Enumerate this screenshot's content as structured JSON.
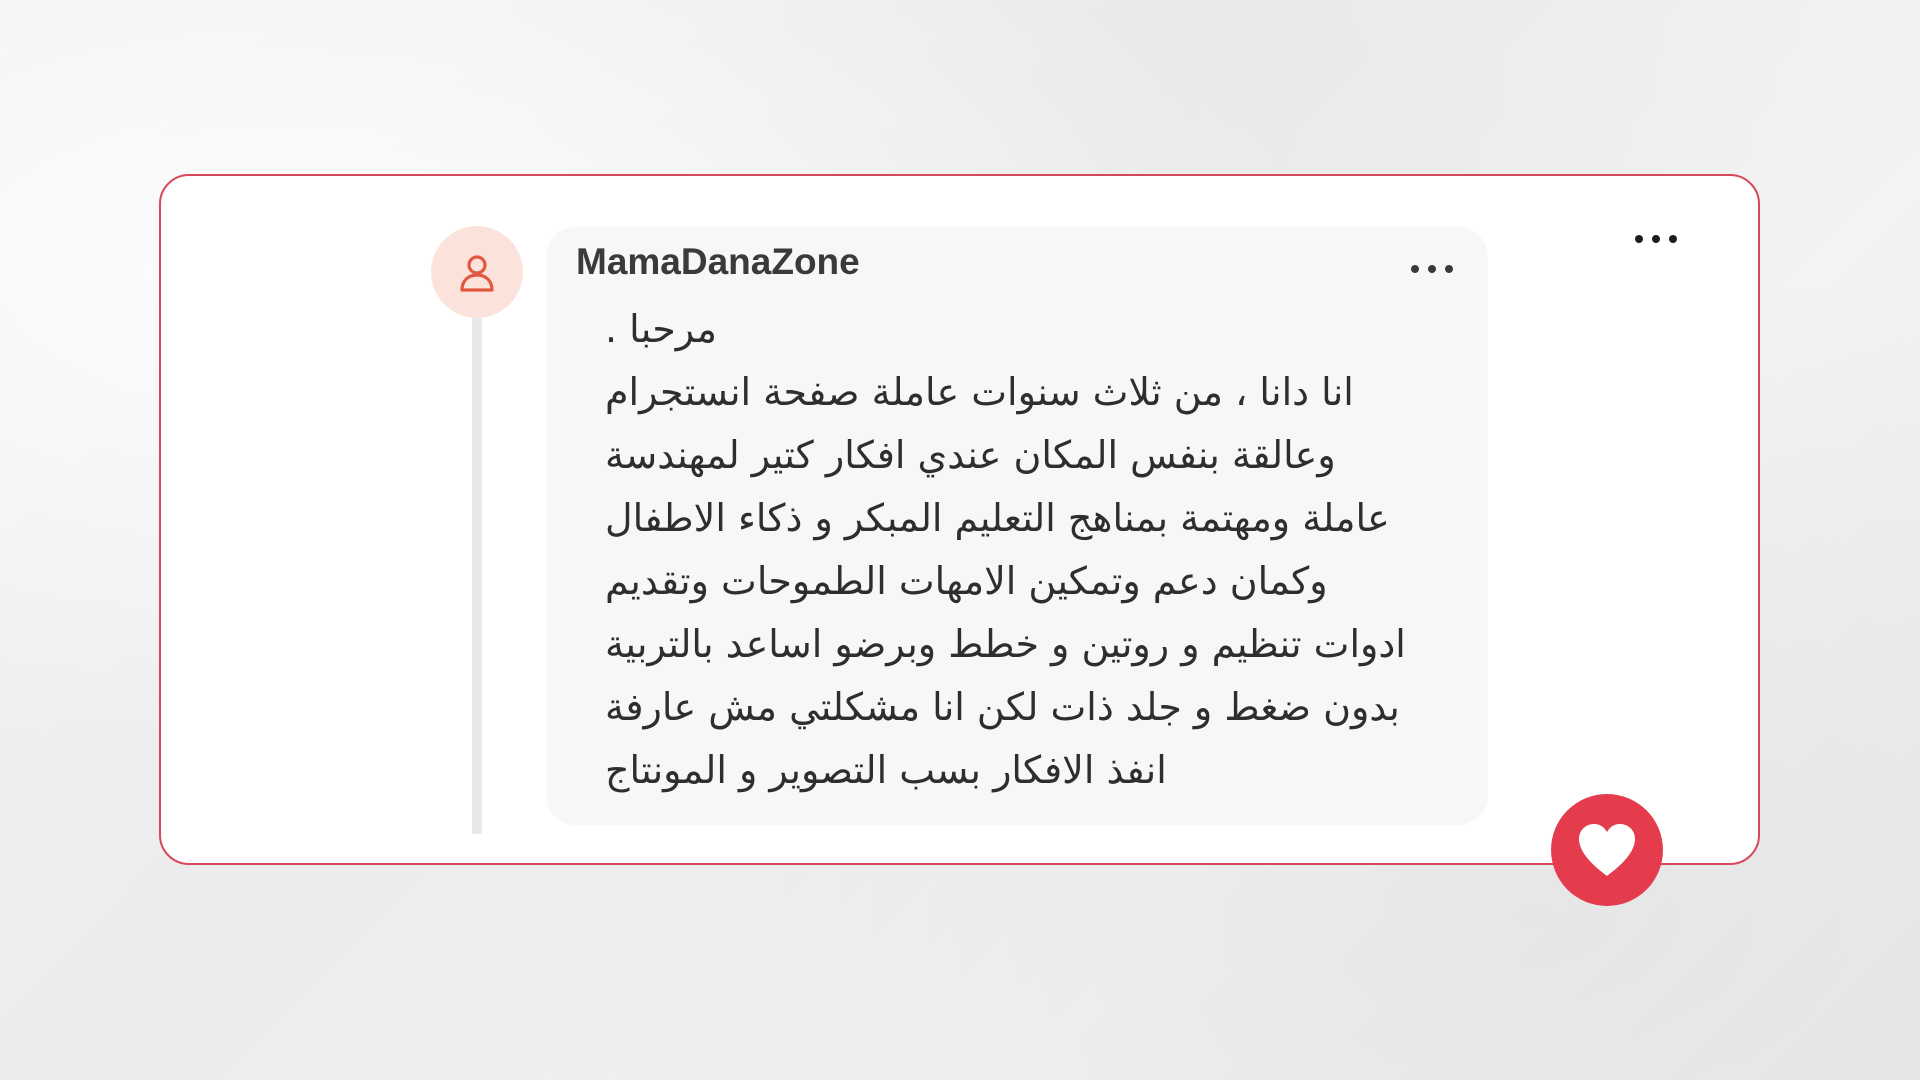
{
  "post": {
    "username": "MamaDanaZone",
    "message_lines": [
      "مرحبا .",
      "انا دانا ، من ثلاث سنوات عاملة صفحة انستجرام",
      "وعالقة بنفس المكان عندي افكار كتير لمهندسة",
      "عاملة ومهتمة بمناهج التعليم المبكر و ذكاء الاطفال",
      "وكمان دعم وتمكين الامهات الطموحات وتقديم",
      "ادوات تنظيم و روتين و خطط وبرضو اساعد بالتربية",
      "بدون ضغط و جلد ذات لكن انا مشكلتي مش عارفة",
      "انفذ الافكار بسب التصوير و المونتاج"
    ]
  },
  "icons": {
    "avatar": "user-icon",
    "card_menu": "more-horizontal-icon",
    "comment_menu": "more-horizontal-icon",
    "like": "heart-icon"
  },
  "colors": {
    "card_border": "#d9475a",
    "heart_button": "#e43b4d",
    "avatar_background": "#fbe3dc",
    "avatar_icon": "#e2573f",
    "bubble_background": "#f7f7f7"
  }
}
